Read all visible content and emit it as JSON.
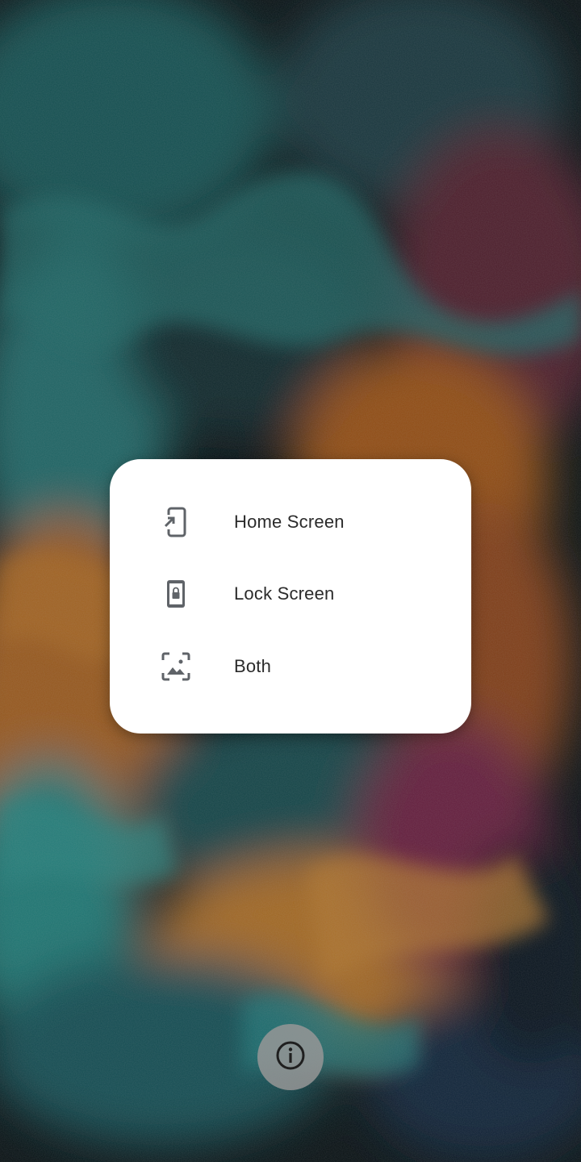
{
  "wallpaper": {
    "description_colors": [
      "#0b1a1e",
      "#1f7f7c",
      "#e08a2a",
      "#7a2f4a",
      "#132a48"
    ]
  },
  "dialog": {
    "options": [
      {
        "label": "Home Screen",
        "icon": "phone-set-home-icon"
      },
      {
        "label": "Lock Screen",
        "icon": "phone-lock-icon"
      },
      {
        "label": "Both",
        "icon": "wallpaper-both-icon"
      }
    ]
  },
  "info_button": {
    "icon": "info-icon"
  },
  "colors": {
    "dialog_bg": "#ffffff",
    "text": "#2b2b2b",
    "icon": "#5f6368",
    "info_button_bg": "#969696"
  }
}
